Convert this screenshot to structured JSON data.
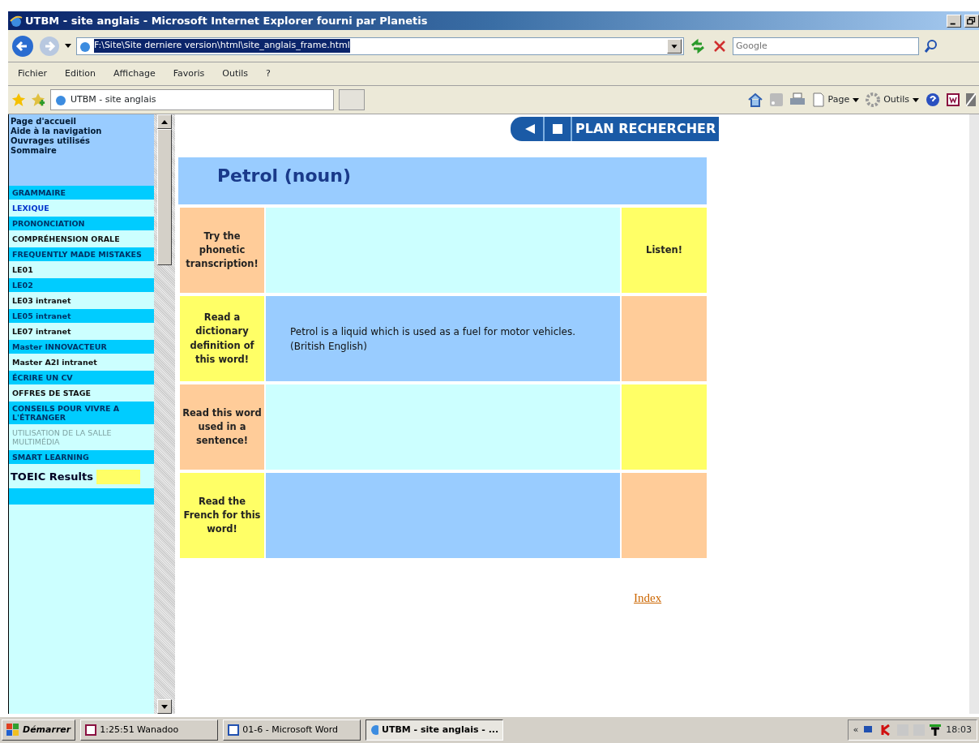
{
  "window": {
    "title": "UTBM - site anglais - Microsoft Internet Explorer fourni par Planetis"
  },
  "address_bar": {
    "value": "F:\\Site\\Site derniere version\\html\\site_anglais_frame.html"
  },
  "search": {
    "placeholder": "Google"
  },
  "menu": [
    "Fichier",
    "Edition",
    "Affichage",
    "Favoris",
    "Outils",
    "?"
  ],
  "tab": {
    "label": "UTBM - site anglais"
  },
  "command_bar": [
    "Page",
    "Outils"
  ],
  "sidebar": {
    "links": [
      "Page d'accueil",
      "Aide à la navigation",
      "Ouvrages utilisés",
      "Sommaire"
    ],
    "items": [
      {
        "label": "GRAMMAIRE",
        "kind": "band",
        "selected": false,
        "disabled": false
      },
      {
        "label": "LEXIQUE",
        "kind": "plain",
        "selected": true,
        "disabled": false
      },
      {
        "label": "PRONONCIATION",
        "kind": "band",
        "selected": false,
        "disabled": false
      },
      {
        "label": "COMPRÉHENSION ORALE",
        "kind": "plain",
        "selected": false,
        "disabled": false
      },
      {
        "label": "FREQUENTLY MADE MISTAKES",
        "kind": "band",
        "selected": false,
        "disabled": false
      },
      {
        "label": "LE01",
        "kind": "plain",
        "selected": false,
        "disabled": false
      },
      {
        "label": "LE02",
        "kind": "band",
        "selected": false,
        "disabled": false
      },
      {
        "label": "LE03 intranet",
        "kind": "plain",
        "selected": false,
        "disabled": false
      },
      {
        "label": "LE05 intranet",
        "kind": "band",
        "selected": false,
        "disabled": false
      },
      {
        "label": "LE07 intranet",
        "kind": "plain",
        "selected": false,
        "disabled": false
      },
      {
        "label": "Master INNOVACTEUR",
        "kind": "band",
        "selected": false,
        "disabled": false
      },
      {
        "label": "Master A2I intranet",
        "kind": "plain",
        "selected": false,
        "disabled": false
      },
      {
        "label": "ÉCRIRE UN CV",
        "kind": "band",
        "selected": false,
        "disabled": false
      },
      {
        "label": "OFFRES DE STAGE",
        "kind": "plain",
        "selected": false,
        "disabled": false
      },
      {
        "label": "CONSEILS POUR VIVRE A L'ÉTRANGER",
        "kind": "band",
        "selected": false,
        "disabled": false
      },
      {
        "label": "UTILISATION DE LA SALLE MULTIMÉDIA",
        "kind": "plain",
        "selected": false,
        "disabled": true
      },
      {
        "label": "SMART LEARNING",
        "kind": "band",
        "selected": false,
        "disabled": false
      }
    ],
    "toeic": {
      "label": "TOEIC Results"
    }
  },
  "nav_bar": {
    "label": "PLAN RECHERCHER"
  },
  "word": {
    "title": "Petrol (noun)"
  },
  "rows": [
    {
      "kind": "odd",
      "prompt": "Try the phonetic transcription!",
      "content": "",
      "action": "Listen!"
    },
    {
      "kind": "even",
      "prompt": "Read a dictionary definition of this word!",
      "content": "Petrol is a liquid which is used as a fuel for motor vehicles. (British English)",
      "action": ""
    },
    {
      "kind": "odd",
      "prompt": "Read this word used in a sentence!",
      "content": "",
      "action": ""
    },
    {
      "kind": "even",
      "prompt": "Read the French for this word!",
      "content": "",
      "action": ""
    }
  ],
  "index_link": "Index",
  "taskbar": {
    "start": "Démarrer",
    "tasks": [
      {
        "label": "1:25:51 Wanadoo",
        "selected": false
      },
      {
        "label": "01-6 - Microsoft Word",
        "selected": false
      },
      {
        "label": "UTBM - site anglais - ...",
        "selected": true
      }
    ],
    "tray_toggle": "«",
    "clock": "18:03"
  }
}
